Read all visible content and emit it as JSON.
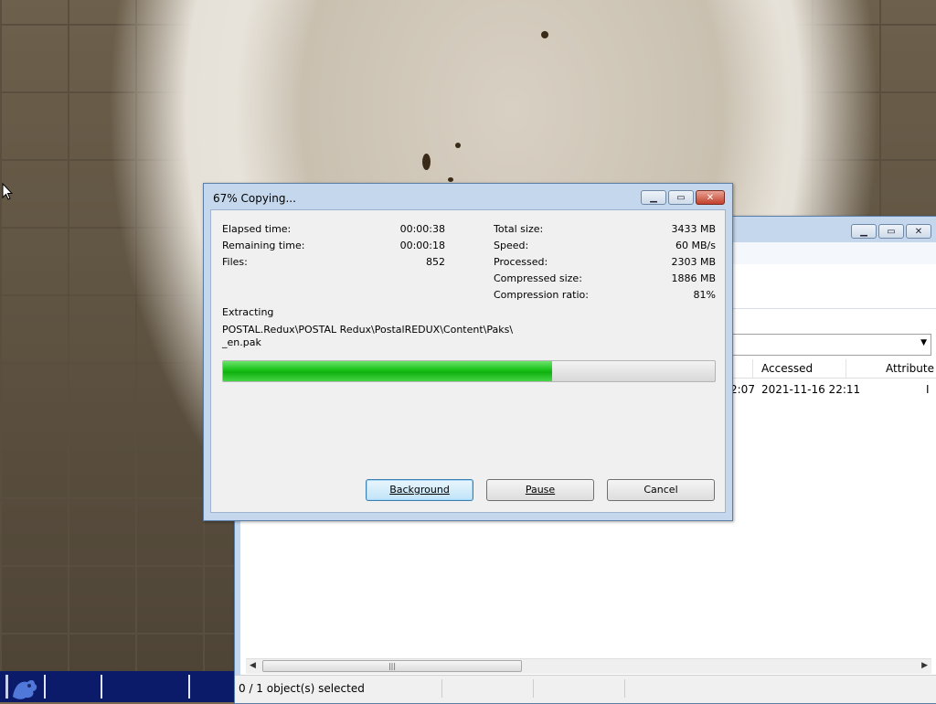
{
  "copy_dialog": {
    "title": "67% Copying...",
    "elapsed_label": "Elapsed time:",
    "elapsed_value": "00:00:38",
    "remaining_label": "Remaining time:",
    "remaining_value": "00:00:18",
    "files_label": "Files:",
    "files_value": "852",
    "total_size_label": "Total size:",
    "total_size_value": "3433 MB",
    "speed_label": "Speed:",
    "speed_value": "60 MB/s",
    "processed_label": "Processed:",
    "processed_value": "2303 MB",
    "compressed_label": "Compressed size:",
    "compressed_value": "1886 MB",
    "ratio_label": "Compression ratio:",
    "ratio_value": "81%",
    "operation_label": "Extracting",
    "path_line1": "POSTAL.Redux\\POSTAL Redux\\PostalREDUX\\Content\\Paks\\",
    "path_line2": "_en.pak",
    "progress": 0.67,
    "buttons": {
      "background": "Background",
      "pause": "Pause",
      "cancel": "Cancel"
    }
  },
  "explorer": {
    "columns": [
      "Accessed",
      "Attribute"
    ],
    "row": {
      "modified_partial": "2:07",
      "accessed": "2021-11-16 22:11",
      "attribute_partial": "I"
    },
    "status": "0 / 1 object(s) selected"
  },
  "icons": {
    "minimize": "minimize-icon",
    "maximize": "maximize-icon",
    "close": "close-icon"
  },
  "colors": {
    "progress_green": "#17c017",
    "taskbar": "#0c1a6a",
    "window_frame": "#c5d7ec"
  }
}
